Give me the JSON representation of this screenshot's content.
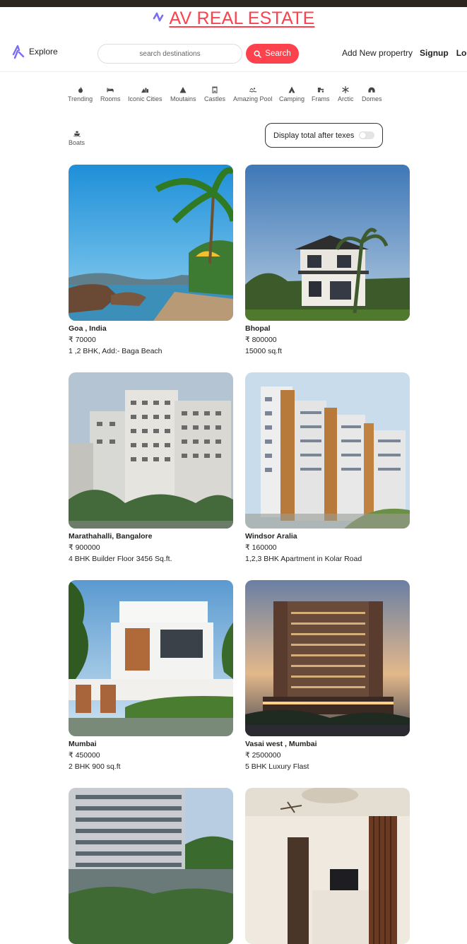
{
  "brand": {
    "title": "AV REAL ESTATE",
    "color": "#fe424d"
  },
  "nav": {
    "explore_label": "Explore",
    "search_placeholder": "search destinations",
    "search_button": "Search",
    "add_property": "Add New propertry",
    "signup": "Signup",
    "login": "Log in"
  },
  "filters": [
    {
      "label": "Trending",
      "icon": "fire-icon"
    },
    {
      "label": "Rooms",
      "icon": "bed-icon"
    },
    {
      "label": "Iconic Cities",
      "icon": "mountain-city-icon"
    },
    {
      "label": "Moutains",
      "icon": "mountain-icon"
    },
    {
      "label": "Castles",
      "icon": "castle-icon"
    },
    {
      "label": "Amazing Pool",
      "icon": "person-swimming-icon"
    },
    {
      "label": "Camping",
      "icon": "campground-icon"
    },
    {
      "label": "Frams",
      "icon": "tractor-icon"
    },
    {
      "label": "Arctic",
      "icon": "snowflake-icon"
    },
    {
      "label": "Domes",
      "icon": "igloo-icon"
    },
    {
      "label": "Boats",
      "icon": "ship-icon"
    }
  ],
  "tax_toggle": {
    "label": "Display total after texes",
    "enabled": false
  },
  "listings": [
    {
      "title": "Goa , India",
      "price": "₹ 70000",
      "description": "1 ,2 BHK, Add:- Baga Beach",
      "scene": "beach"
    },
    {
      "title": "Bhopal",
      "price": "₹ 800000",
      "description": "15000 sq.ft",
      "scene": "villa"
    },
    {
      "title": "Marathahalli, Bangalore",
      "price": "₹ 900000",
      "description": "4 BHK Builder Floor 3456 Sq.ft.",
      "scene": "apartments-white"
    },
    {
      "title": "Windsor Aralia",
      "price": "₹ 160000",
      "description": "1,2,3 BHK Apartment in Kolar Road",
      "scene": "apartments-wood"
    },
    {
      "title": "Mumbai",
      "price": "₹ 450000",
      "description": "2 BHK 900 sq.ft",
      "scene": "modern-house"
    },
    {
      "title": "Vasai west , Mumbai",
      "price": "₹ 2500000",
      "description": "5 BHK Luxury Flast",
      "scene": "tower-night"
    },
    {
      "title": "",
      "price": "",
      "description": "",
      "scene": "highrise-curved"
    },
    {
      "title": "",
      "price": "",
      "description": "",
      "scene": "interior"
    }
  ]
}
